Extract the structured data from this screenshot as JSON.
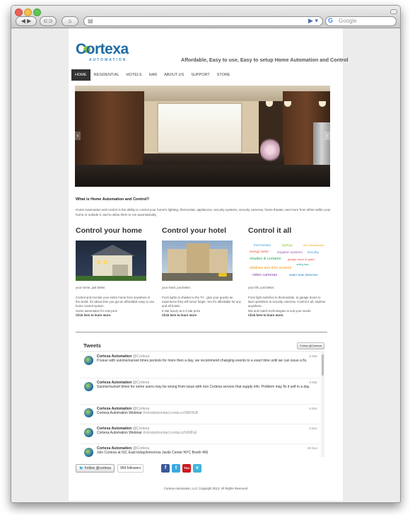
{
  "browser": {
    "search_placeholder": "Google",
    "back_icon": "back-forward-arrows",
    "home_icon": "home"
  },
  "header": {
    "logo_text": "Cortexa",
    "logo_sub": "AUTOMATION",
    "tagline": "Affordable, Easy to use, Easy to setup Home Automation and Control"
  },
  "nav": {
    "items": [
      "HOME",
      "RESIDENTIAL",
      "HOTELS",
      "HAR",
      "ABOUT US",
      "SUPPORT",
      "STORE"
    ]
  },
  "about": {
    "heading": "What is Home Automation and Control?",
    "text": "Home Automation and control is the ability to control your home's lighting, thermostat, appliances, security systems, security cameras, home theater, and more from either within your home or outside it, and to allow them to run automatically."
  },
  "columns": [
    {
      "title": "Control your home",
      "caption": "your home, just better.",
      "body": "Control and monitor your entire home from anywhere in the world. It's about time you got an affordable easy to use home control system.",
      "extra": "Home automation for everyone",
      "link": "Click here to learn more."
    },
    {
      "title": "Control your hotel",
      "caption": "your hotel, just better.",
      "body": "From lights to shades to the TV , give your guests an experience they will never forget. Yes it's affordable for any and all hotels.",
      "extra": "5 star luxury at a 3 star price",
      "link": "Click here to learn more"
    },
    {
      "title": "Control it all",
      "caption": "your life, just better.",
      "body": "From light switches to thermostats, to garage doors to lawn sprinklers to security cameras. Control it all, anytime anywhere.",
      "extra": "Mix and match technologies to suit your needs.",
      "link": "Click here to learn more."
    }
  ],
  "word_cloud": [
    {
      "text": "thermostats",
      "color": "#4aa3df"
    },
    {
      "text": "lighting",
      "color": "#8cc63f"
    },
    {
      "text": "A/V entertainment",
      "color": "#f39c12"
    },
    {
      "text": "energy meter",
      "color": "#e74c3c"
    },
    {
      "text": "irrigation systems",
      "color": "#9b59b6"
    },
    {
      "text": "security",
      "color": "#3498db"
    },
    {
      "text": "shades & curtains",
      "color": "#27ae60"
    },
    {
      "text": "garage doors & gates",
      "color": "#e74c3c"
    },
    {
      "text": "ceiling fans",
      "color": "#16a085"
    },
    {
      "text": "windows and door sensors",
      "color": "#f39c12"
    },
    {
      "text": "video cameras",
      "color": "#8e44ad"
    },
    {
      "text": "water leak detection",
      "color": "#2e86c1"
    }
  ],
  "tweets": {
    "title": "Tweets",
    "follow_label": "Follow @Cortexa",
    "items": [
      {
        "name": "Cortexa Automation",
        "handle": "@Cortexa",
        "date": "6 Mar",
        "text": "If issue with sunrise/sunset times persists for more then a day, we recommend changing events to a exact time until we can issue a fix.",
        "link": ""
      },
      {
        "name": "Cortexa Automation",
        "handle": "@Cortexa",
        "date": "6 Mar",
        "text": "Sunrise/sunset times for some users may be wrong from issue with non Cortexa servers that supply info. Problem may fix it self in a day.",
        "link": ""
      },
      {
        "name": "Cortexa Automation",
        "handle": "@Cortexa",
        "date": "5 Dec",
        "text": "Cortexa Automation Webinar",
        "link": "#constantcontact.conta.cc/SBV6cB"
      },
      {
        "name": "Cortexa Automation",
        "handle": "@Cortexa",
        "date": "3 Dec",
        "text": "Cortexa Automation Webinar",
        "link": "#constantcontact.conta.cc/VE8Fgl"
      },
      {
        "name": "Cortexa Automation",
        "handle": "@Cortexa",
        "date": "28 Nov",
        "text": "Join Cortexa at ISC East today/tomorrow Javits Center NYC Booth 466",
        "link": ""
      }
    ]
  },
  "footer": {
    "follow_button": "Follow @cortexa",
    "followers": "969 followers",
    "social": [
      "f",
      "t",
      "You",
      "v"
    ],
    "copyright": "Cortexa Automation, LLC Copyright 2013. All Rights Reserved"
  }
}
